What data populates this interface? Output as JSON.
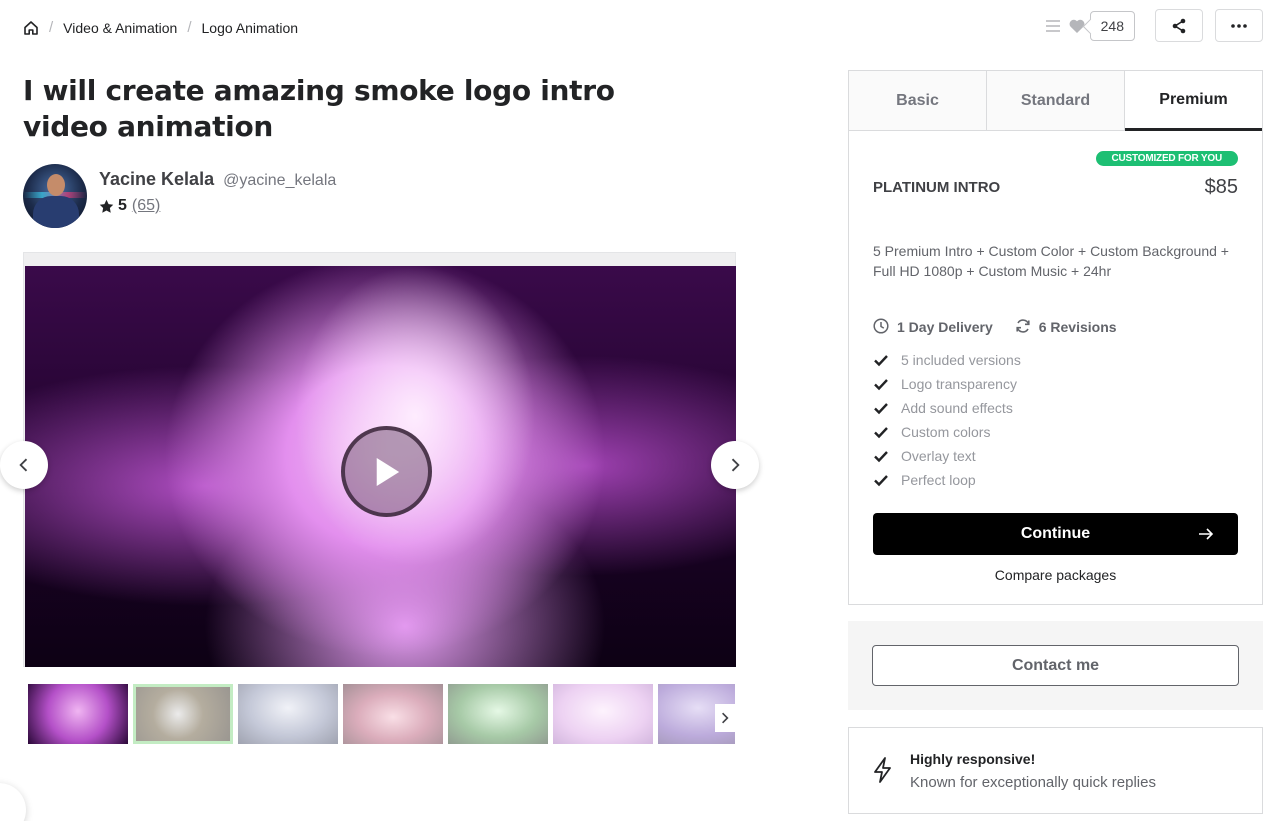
{
  "breadcrumb": {
    "items": [
      "Video & Animation",
      "Logo Animation"
    ]
  },
  "actions": {
    "likes_count": "248"
  },
  "gig": {
    "title": "I will create amazing smoke logo intro video animation"
  },
  "seller": {
    "name": "Yacine Kelala",
    "handle": "@yacine_kelala",
    "rating": "5",
    "reviews": "(65)"
  },
  "packages": {
    "tabs": [
      "Basic",
      "Standard",
      "Premium"
    ],
    "active_tab": "Premium",
    "badge": "CUSTOMIZED FOR YOU",
    "name": "PLATINUM INTRO",
    "price": "$85",
    "description": "5 Premium Intro + Custom Color + Custom Background + Full HD 1080p + Custom Music + 24hr",
    "delivery": "1 Day Delivery",
    "revisions": "6 Revisions",
    "features": [
      "5 included versions",
      "Logo transparency",
      "Add sound effects",
      "Custom colors",
      "Overlay text",
      "Perfect loop"
    ],
    "continue_label": "Continue",
    "compare_label": "Compare packages"
  },
  "contact": {
    "button_label": "Contact me"
  },
  "responsive": {
    "title": "Highly responsive!",
    "subtitle": "Known for exceptionally quick replies"
  },
  "colors": {
    "accent_green": "#1dbf73",
    "primary_button": "#000000"
  }
}
